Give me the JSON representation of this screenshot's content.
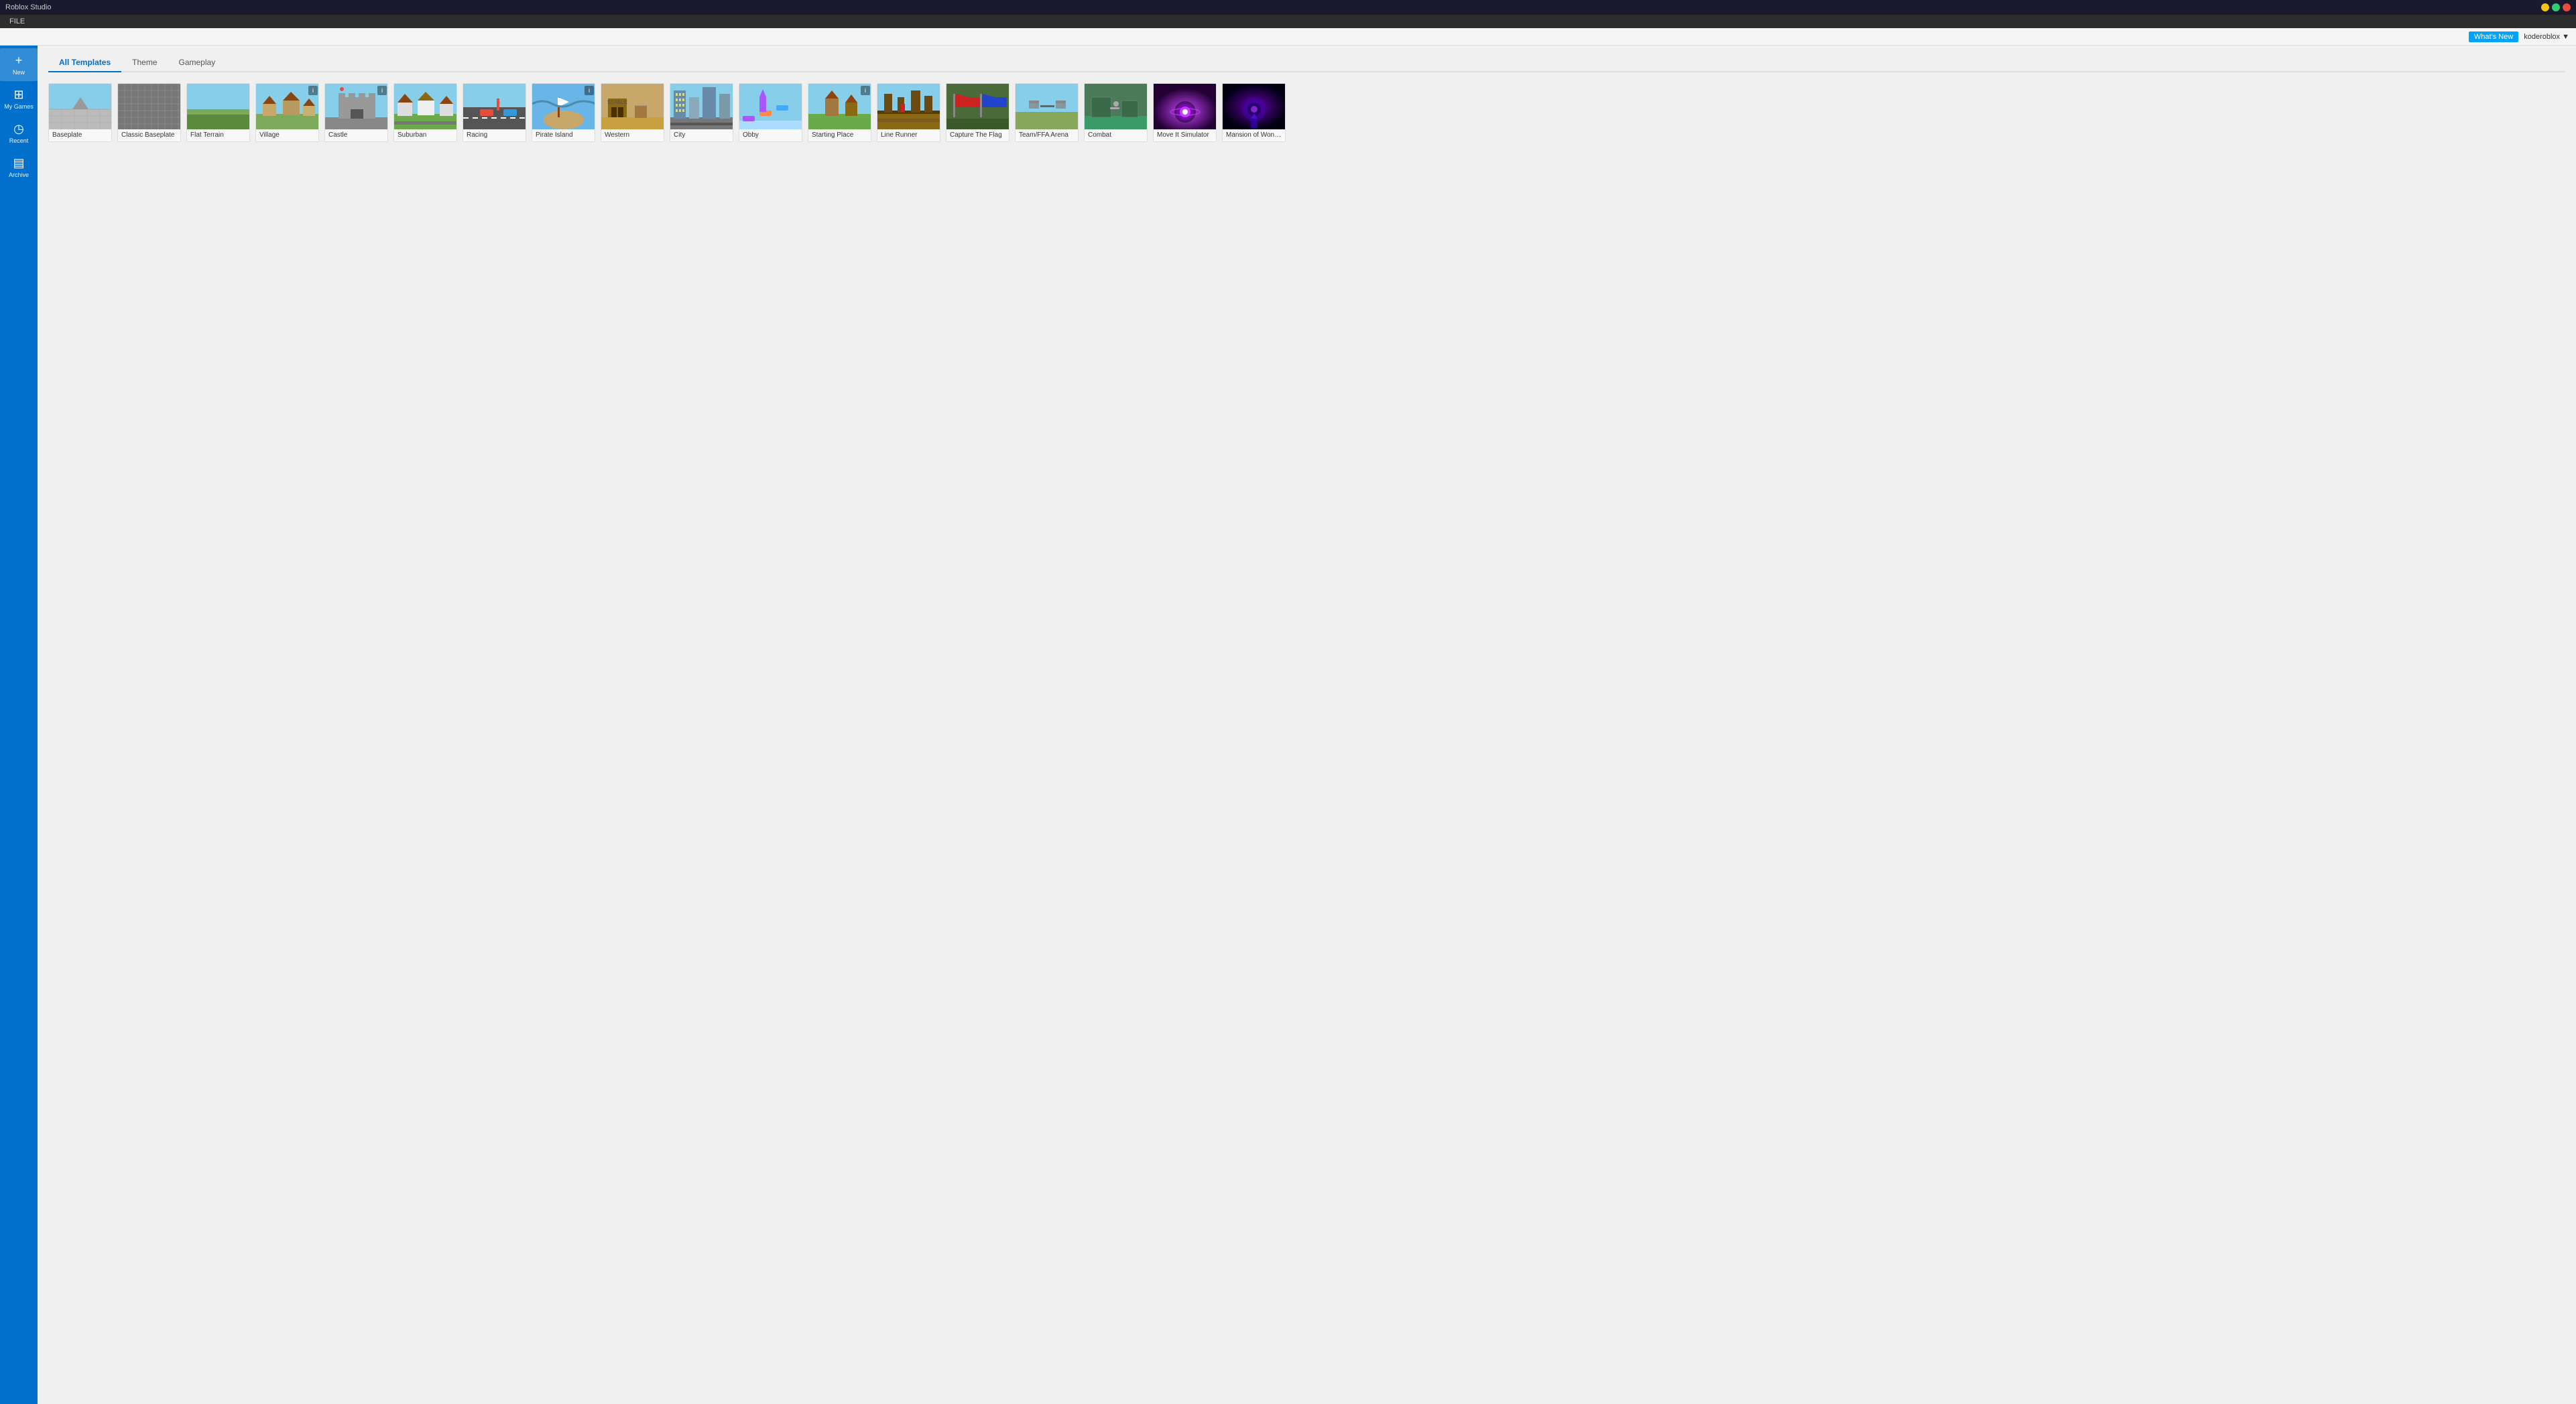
{
  "app": {
    "title": "Roblox Studio",
    "menu_items": [
      "FILE"
    ]
  },
  "topbar": {
    "whats_new": "What's New",
    "username": "koderoblox ▼"
  },
  "sidebar": {
    "items": [
      {
        "id": "new",
        "label": "New",
        "icon": "+"
      },
      {
        "id": "my-games",
        "label": "My Games",
        "icon": "🎮"
      },
      {
        "id": "recent",
        "label": "Recent",
        "icon": "🕐"
      },
      {
        "id": "archive",
        "label": "Archive",
        "icon": "📁"
      }
    ]
  },
  "tabs": [
    {
      "id": "all",
      "label": "All Templates",
      "active": true
    },
    {
      "id": "theme",
      "label": "Theme",
      "active": false
    },
    {
      "id": "gameplay",
      "label": "Gameplay",
      "active": false
    }
  ],
  "templates": [
    {
      "id": "baseplate",
      "name": "Baseplate",
      "thumb_class": "thumb-baseplate",
      "has_info": false
    },
    {
      "id": "classic-baseplate",
      "name": "Classic Baseplate",
      "thumb_class": "thumb-classic",
      "has_info": false
    },
    {
      "id": "flat-terrain",
      "name": "Flat Terrain",
      "thumb_class": "thumb-flat",
      "has_info": false
    },
    {
      "id": "village",
      "name": "Village",
      "thumb_class": "thumb-village",
      "has_info": true
    },
    {
      "id": "castle",
      "name": "Castle",
      "thumb_class": "thumb-castle",
      "has_info": true
    },
    {
      "id": "suburban",
      "name": "Suburban",
      "thumb_class": "thumb-suburban",
      "has_info": false
    },
    {
      "id": "racing",
      "name": "Racing",
      "thumb_class": "thumb-racing",
      "has_info": false
    },
    {
      "id": "pirate-island",
      "name": "Pirate Island",
      "thumb_class": "thumb-pirate",
      "has_info": true
    },
    {
      "id": "western",
      "name": "Western",
      "thumb_class": "thumb-western",
      "has_info": false
    },
    {
      "id": "city",
      "name": "City",
      "thumb_class": "thumb-city",
      "has_info": false
    },
    {
      "id": "obby",
      "name": "Obby",
      "thumb_class": "thumb-obby",
      "has_info": false
    },
    {
      "id": "starting-place",
      "name": "Starting Place",
      "thumb_class": "thumb-starting",
      "has_info": true
    },
    {
      "id": "line-runner",
      "name": "Line Runner",
      "thumb_class": "thumb-linerunner",
      "has_info": false
    },
    {
      "id": "capture-the-flag",
      "name": "Capture The Flag",
      "thumb_class": "thumb-capture",
      "has_info": false
    },
    {
      "id": "team-ffa-arena",
      "name": "Team/FFA Arena",
      "thumb_class": "thumb-team",
      "has_info": false
    },
    {
      "id": "combat",
      "name": "Combat",
      "thumb_class": "thumb-combat",
      "has_info": false
    },
    {
      "id": "move-it-simulator",
      "name": "Move It Simulator",
      "thumb_class": "thumb-moveit",
      "has_info": false
    },
    {
      "id": "mansion-of-wonder",
      "name": "Mansion of Wonder",
      "thumb_class": "thumb-mansion",
      "has_info": false
    }
  ]
}
